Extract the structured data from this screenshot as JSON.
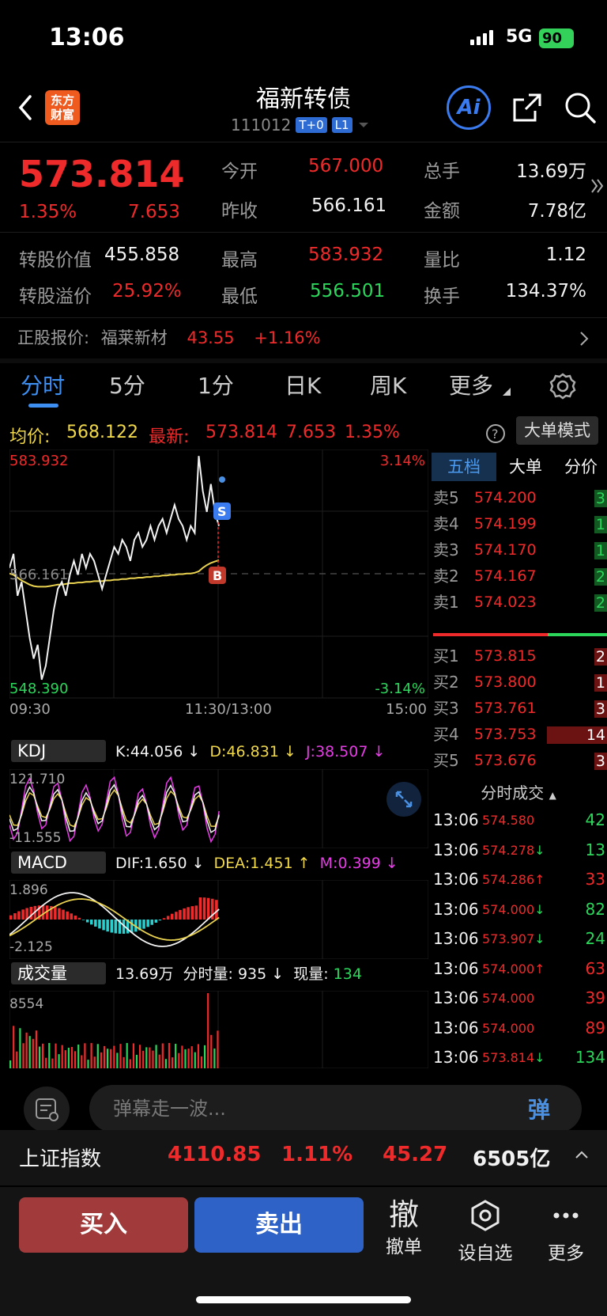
{
  "status": {
    "time": "13:06",
    "network": "5G",
    "battery": "90"
  },
  "header": {
    "title": "福新转债",
    "code": "111012",
    "tag1": "T+0",
    "tag2": "L1",
    "logo_line1": "东方",
    "logo_line2": "财富",
    "ai_label": "Ai"
  },
  "quote": {
    "price": "573.814",
    "pct": "1.35%",
    "change": "7.653",
    "open_label": "今开",
    "open": "567.000",
    "prev_label": "昨收",
    "prev": "566.161",
    "vol_label": "总手",
    "vol": "13.69万",
    "amt_label": "金额",
    "amt": "7.78亿",
    "conv_value_label": "转股价值",
    "conv_value": "455.858",
    "high_label": "最高",
    "high": "583.932",
    "ratio_label": "量比",
    "ratio": "1.12",
    "premium_label": "转股溢价",
    "premium": "25.92%",
    "low_label": "最低",
    "low": "556.501",
    "turnover_label": "换手",
    "turnover": "134.37%",
    "stock_label": "正股报价:",
    "stock_name": "福莱新材",
    "stock_price": "43.55",
    "stock_pct": "+1.16%"
  },
  "tabs": [
    "分时",
    "5分",
    "1分",
    "日K",
    "周K",
    "更多"
  ],
  "info": {
    "avg_label": "均价:",
    "avg": "568.122",
    "last_label": "最新:",
    "last": "573.814",
    "chg": "7.653",
    "pct": "1.35%",
    "mode_button": "大单模式"
  },
  "chart_data": {
    "type": "line",
    "title": "",
    "y_high": "583.932",
    "y_low": "548.390",
    "y_mid": "566.161",
    "pct_high": "3.14%",
    "pct_low": "-3.14%",
    "x_ticks": [
      "09:30",
      "11:30/13:00",
      "15:00"
    ],
    "ylim": [
      548.39,
      583.932
    ],
    "series": [
      {
        "values": [
          567,
          569,
          563,
          565,
          561,
          557,
          554,
          556,
          551,
          553,
          557,
          561,
          564,
          565,
          563,
          566,
          568,
          566,
          569,
          567,
          569,
          568,
          566,
          564,
          566,
          568,
          570,
          569,
          571,
          570,
          568,
          571,
          572,
          570,
          571,
          573,
          571,
          573,
          574,
          572,
          574,
          576,
          574,
          573,
          571,
          573,
          572,
          583,
          578,
          575,
          579,
          575,
          573
        ]
      },
      {
        "values": [
          566.2,
          566.0,
          565.6,
          565.2,
          564.9,
          564.6,
          564.4,
          564.3,
          564.3,
          564.3,
          564.4,
          564.5,
          564.6,
          564.6,
          564.7,
          564.8,
          564.8,
          564.9,
          564.9,
          565.0,
          565.0,
          565.1,
          565.1,
          565.1,
          565.2,
          565.2,
          565.3,
          565.3,
          565.4,
          565.4,
          565.5,
          565.5,
          565.6,
          565.6,
          565.7,
          565.7,
          565.8,
          565.8,
          565.9,
          565.9,
          566.0,
          566.0,
          566.1,
          566.1,
          566.2,
          566.2,
          566.3,
          566.5,
          567.0,
          567.4,
          567.7,
          567.9,
          568.1
        ]
      }
    ]
  },
  "kdj": {
    "name": "KDJ",
    "k": "K:44.056 ↓",
    "d": "D:46.831 ↓",
    "j": "J:38.507 ↓",
    "top": "121.710",
    "bottom": "-11.555"
  },
  "macd": {
    "name": "MACD",
    "dif": "DIF:1.650 ↓",
    "dea": "DEA:1.451 ↑",
    "m": "M:0.399 ↓",
    "top": "1.896",
    "bottom": "-2.125"
  },
  "volume": {
    "name": "成交量",
    "total": "13.69万",
    "minute": "分时量: 935 ↓",
    "now_label": "现量:",
    "now": "134",
    "top": "8554"
  },
  "book": {
    "tabs": [
      "五档",
      "大单",
      "分价"
    ],
    "asks": [
      {
        "label": "卖5",
        "price": "574.200",
        "qty": "3"
      },
      {
        "label": "卖4",
        "price": "574.199",
        "qty": "1"
      },
      {
        "label": "卖3",
        "price": "574.170",
        "qty": "1"
      },
      {
        "label": "卖2",
        "price": "574.167",
        "qty": "2"
      },
      {
        "label": "卖1",
        "price": "574.023",
        "qty": "2"
      }
    ],
    "bids": [
      {
        "label": "买1",
        "price": "573.815",
        "qty": "2"
      },
      {
        "label": "买2",
        "price": "573.800",
        "qty": "1"
      },
      {
        "label": "买3",
        "price": "573.761",
        "qty": "3"
      },
      {
        "label": "买4",
        "price": "573.753",
        "qty": "14"
      },
      {
        "label": "买5",
        "price": "573.676",
        "qty": "3"
      }
    ],
    "ticks_label": "分时成交",
    "ticks": [
      {
        "time": "13:06",
        "price": "574.580",
        "arrow": "",
        "qty": "42",
        "color": "green"
      },
      {
        "time": "13:06",
        "price": "574.278",
        "arrow": "↓",
        "qty": "13",
        "color": "green"
      },
      {
        "time": "13:06",
        "price": "574.286",
        "arrow": "↑",
        "qty": "33",
        "color": "red"
      },
      {
        "time": "13:06",
        "price": "574.000",
        "arrow": "↓",
        "qty": "82",
        "color": "green"
      },
      {
        "time": "13:06",
        "price": "573.907",
        "arrow": "↓",
        "qty": "24",
        "color": "green"
      },
      {
        "time": "13:06",
        "price": "574.000",
        "arrow": "↑",
        "qty": "63",
        "color": "red"
      },
      {
        "time": "13:06",
        "price": "574.000",
        "arrow": "",
        "qty": "39",
        "color": "red"
      },
      {
        "time": "13:06",
        "price": "574.000",
        "arrow": "",
        "qty": "89",
        "color": "red"
      },
      {
        "time": "13:06",
        "price": "573.814",
        "arrow": "↓",
        "qty": "134",
        "color": "green"
      }
    ]
  },
  "danmu": {
    "placeholder": "弹幕走一波...",
    "send": "弹"
  },
  "index": {
    "name": "上证指数",
    "value": "4110.85",
    "pct": "1.11%",
    "chg": "45.27",
    "amount": "6505亿"
  },
  "actions": {
    "buy": "买入",
    "sell": "卖出",
    "cancel_icon": "撤",
    "cancel": "撤单",
    "watch": "设自选",
    "more": "更多"
  }
}
